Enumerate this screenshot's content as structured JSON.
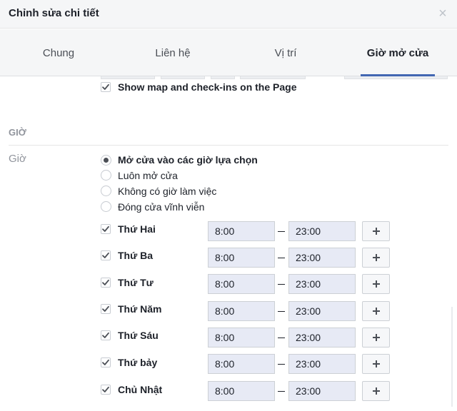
{
  "dialog": {
    "title": "Chỉnh sửa chi tiết",
    "close_symbol": "×"
  },
  "tabs": [
    {
      "label": "Chung",
      "active": false
    },
    {
      "label": "Liên hệ",
      "active": false
    },
    {
      "label": "Vị trí",
      "active": false
    },
    {
      "label": "Giờ mở cửa",
      "active": true
    }
  ],
  "location": {
    "show_map_label": "Show map and check-ins on the Page",
    "show_map_checked": true
  },
  "hours_section": {
    "heading": "GIỜ",
    "field_label": "Giờ",
    "options": [
      {
        "label": "Mở cửa vào các giờ lựa chọn",
        "selected": true
      },
      {
        "label": "Luôn mở cửa",
        "selected": false
      },
      {
        "label": "Không có giờ làm việc",
        "selected": false
      },
      {
        "label": "Đóng cửa vĩnh viễn",
        "selected": false
      }
    ],
    "days": [
      {
        "name": "Thứ Hai",
        "checked": true,
        "open": "8:00",
        "close": "23:00"
      },
      {
        "name": "Thứ Ba",
        "checked": true,
        "open": "8:00",
        "close": "23:00"
      },
      {
        "name": "Thứ Tư",
        "checked": true,
        "open": "8:00",
        "close": "23:00"
      },
      {
        "name": "Thứ Năm",
        "checked": true,
        "open": "8:00",
        "close": "23:00"
      },
      {
        "name": "Thứ Sáu",
        "checked": true,
        "open": "8:00",
        "close": "23:00"
      },
      {
        "name": "Thứ bảy",
        "checked": true,
        "open": "8:00",
        "close": "23:00"
      },
      {
        "name": "Chủ Nhật",
        "checked": true,
        "open": "8:00",
        "close": "23:00"
      }
    ]
  },
  "colors": {
    "accent": "#4267b2",
    "time_field_bg": "#e7eaf5",
    "header_bg": "#f5f6f7"
  }
}
